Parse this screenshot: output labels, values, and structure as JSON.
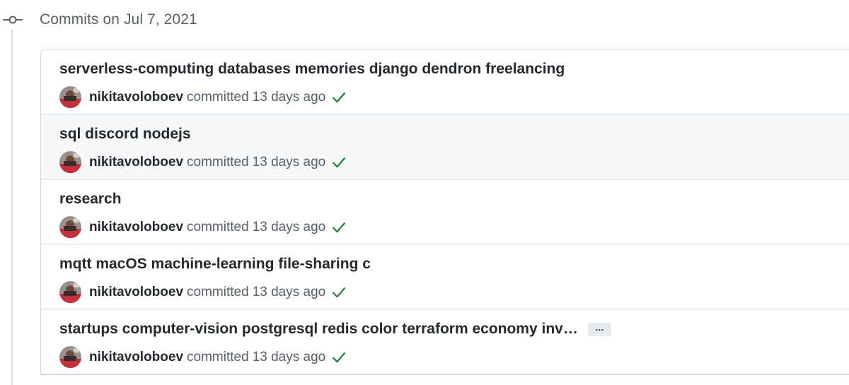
{
  "timeline": {
    "date_heading": "Commits on Jul 7, 2021",
    "node_icon": "git-commit-icon"
  },
  "colors": {
    "success": "#1a7f37",
    "border": "#d0d7de",
    "muted_text": "#57606a",
    "row_highlight": "#f6f8fa"
  },
  "commits": [
    {
      "title": "serverless-computing databases memories django dendron freelancing",
      "author": "nikitavoloboev",
      "action": "committed",
      "time": "13 days ago",
      "status_icon": "check-icon",
      "has_ellipsis": false
    },
    {
      "title": "sql discord nodejs",
      "author": "nikitavoloboev",
      "action": "committed",
      "time": "13 days ago",
      "status_icon": "check-icon",
      "has_ellipsis": false
    },
    {
      "title": "research",
      "author": "nikitavoloboev",
      "action": "committed",
      "time": "13 days ago",
      "status_icon": "check-icon",
      "has_ellipsis": false
    },
    {
      "title": "mqtt macOS machine-learning file-sharing c",
      "author": "nikitavoloboev",
      "action": "committed",
      "time": "13 days ago",
      "status_icon": "check-icon",
      "has_ellipsis": false
    },
    {
      "title": "startups computer-vision postgresql redis color terraform economy inv…",
      "author": "nikitavoloboev",
      "action": "committed",
      "time": "13 days ago",
      "status_icon": "check-icon",
      "has_ellipsis": true,
      "ellipsis_label": "…"
    }
  ]
}
